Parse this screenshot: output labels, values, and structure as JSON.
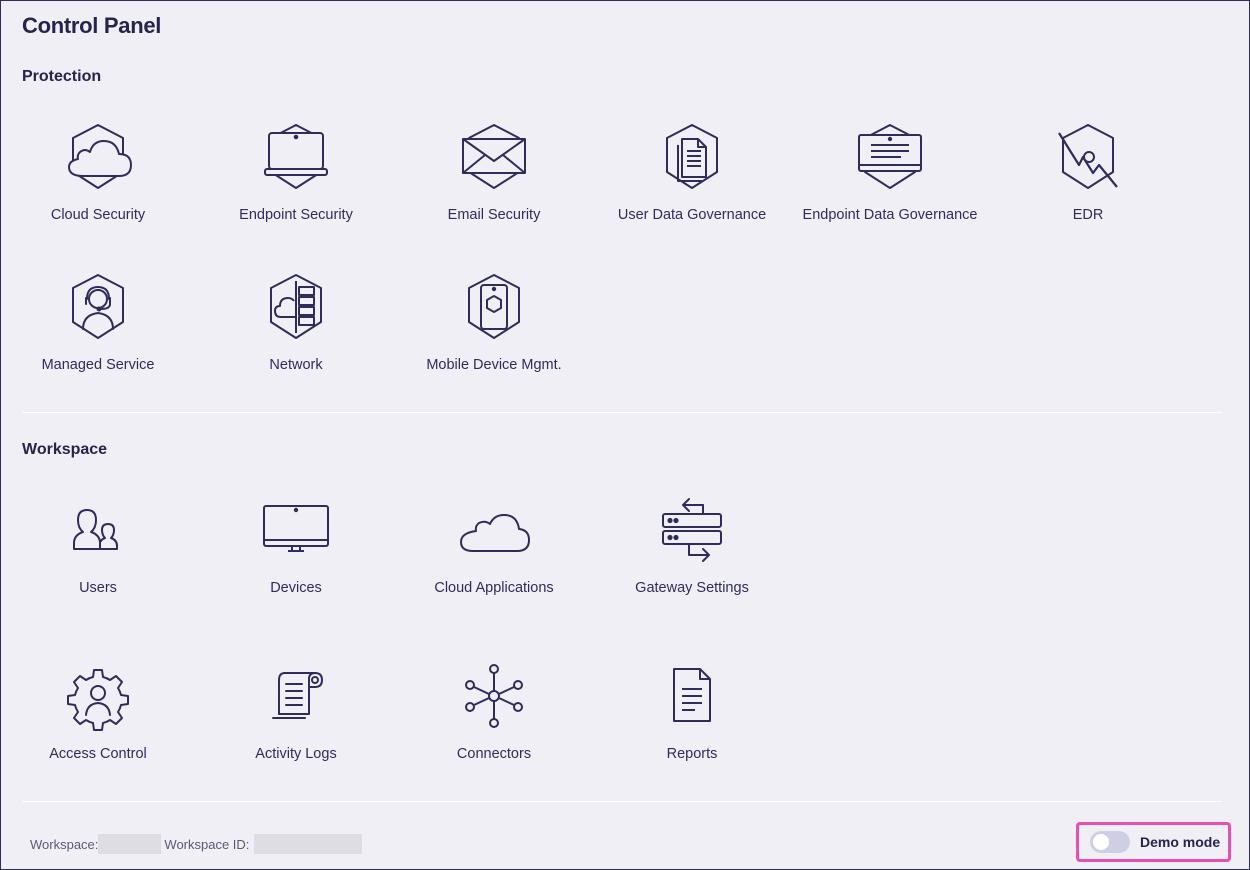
{
  "title": "Control Panel",
  "protection": {
    "heading": "Protection",
    "items": [
      {
        "label": "Cloud Security",
        "icon": "cloud-shield-icon"
      },
      {
        "label": "Endpoint Security",
        "icon": "laptop-shield-icon"
      },
      {
        "label": "Email Security",
        "icon": "envelope-shield-icon"
      },
      {
        "label": "User Data Governance",
        "icon": "document-shield-icon"
      },
      {
        "label": "Endpoint Data Governance",
        "icon": "monitor-data-shield-icon"
      },
      {
        "label": "EDR",
        "icon": "edr-shield-icon"
      },
      {
        "label": "Managed Service",
        "icon": "headset-agent-icon"
      },
      {
        "label": "Network",
        "icon": "network-shield-icon"
      },
      {
        "label": "Mobile Device Mgmt.",
        "icon": "mobile-shield-icon"
      }
    ]
  },
  "workspace": {
    "heading": "Workspace",
    "items": [
      {
        "label": "Users",
        "icon": "users-icon"
      },
      {
        "label": "Devices",
        "icon": "monitor-icon"
      },
      {
        "label": "Cloud Applications",
        "icon": "cloud-icon"
      },
      {
        "label": "Gateway Settings",
        "icon": "gateway-server-icon"
      },
      {
        "label": "Access Control",
        "icon": "user-gear-icon"
      },
      {
        "label": "Activity Logs",
        "icon": "scroll-log-icon"
      },
      {
        "label": "Connectors",
        "icon": "hub-connectors-icon"
      },
      {
        "label": "Reports",
        "icon": "report-document-icon"
      }
    ]
  },
  "footer": {
    "workspace_label": "Workspace:",
    "workspace_id_label": "Workspace ID:",
    "demo_mode_label": "Demo mode",
    "demo_mode_on": false
  },
  "colors": {
    "background": "#f0eff5",
    "ink": "#26234d",
    "highlight": "#e84fb1",
    "toggle_off": "#cfcfe3"
  }
}
